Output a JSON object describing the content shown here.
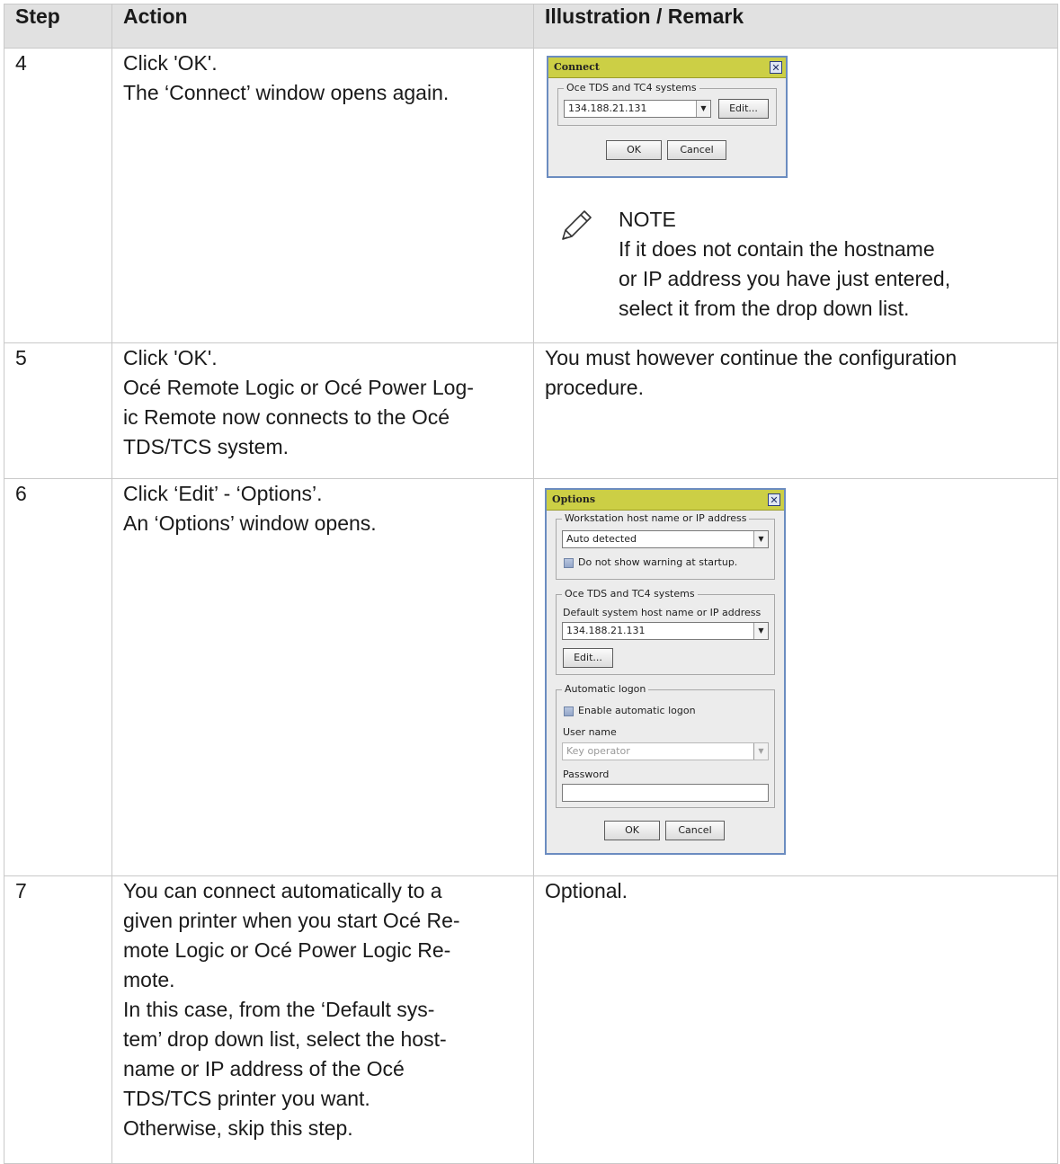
{
  "table": {
    "headers": [
      "Step",
      "Action",
      "Illustration / Remark"
    ]
  },
  "rows": [
    {
      "step": "4",
      "action": [
        "Click 'OK'.",
        "The ‘Connect’ window opens again."
      ],
      "connect_dialog": {
        "title": "Connect",
        "group_label": "Oce TDS and TC4 systems",
        "host_value": "134.188.21.131",
        "edit_label": "Edit...",
        "ok_label": "OK",
        "cancel_label": "Cancel"
      },
      "note": {
        "heading": "NOTE",
        "lines": [
          "If it does not contain the hostname",
          "or IP address you have just entered,",
          "select it from the drop down list."
        ]
      }
    },
    {
      "step": "5",
      "action": [
        "Click 'OK'.",
        "Océ Remote Logic or Océ Power Log-",
        "ic Remote now connects to the Océ",
        "TDS/TCS system."
      ],
      "remark": [
        "You must however continue the configuration",
        "procedure."
      ]
    },
    {
      "step": "6",
      "action": [
        "Click ‘Edit’ - ‘Options’.",
        "An ‘Options’ window opens."
      ],
      "options_dialog": {
        "title": "Options",
        "workstation_group": "Workstation host name or IP address",
        "workstation_value": "Auto detected",
        "no_warning_label": "Do not show warning at startup.",
        "systems_group": "Oce TDS and TC4 systems",
        "default_host_label": "Default system host name or IP address",
        "default_host_value": "134.188.21.131",
        "edit_label": "Edit...",
        "logon_group": "Automatic logon",
        "enable_logon_label": "Enable automatic logon",
        "user_name_label": "User name",
        "user_name_value": "Key operator",
        "password_label": "Password",
        "ok_label": "OK",
        "cancel_label": "Cancel"
      }
    },
    {
      "step": "7",
      "action": [
        "You can connect automatically to a",
        "given printer when you start Océ Re-",
        "mote Logic or Océ Power Logic Re-",
        "mote.",
        "In this case, from the ‘Default sys-",
        "tem’ drop down list, select the host-",
        "name or IP address of the Océ",
        "TDS/TCS printer you want.",
        "Otherwise, skip this step."
      ],
      "remark": [
        "Optional."
      ]
    }
  ]
}
